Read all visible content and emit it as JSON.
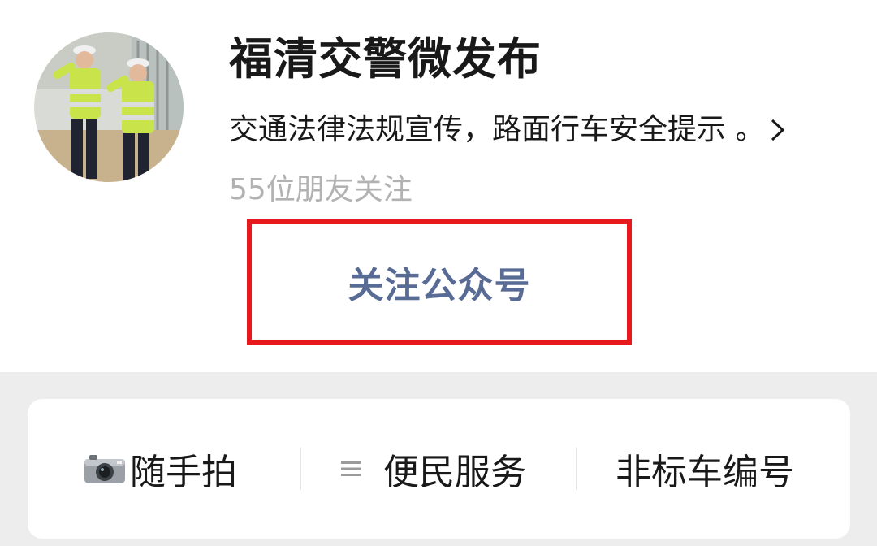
{
  "profile": {
    "account_name": "福清交警微发布",
    "description": "交通法律法规宣传，路面行车安全提示 。",
    "follower_count": "55位朋友关注",
    "follow_button_label": "关注公众号"
  },
  "menu": {
    "items": [
      {
        "label": "随手拍",
        "icon": "camera-icon"
      },
      {
        "label": "便民服务",
        "icon": "list-icon"
      },
      {
        "label": "非标车编号",
        "icon": ""
      }
    ]
  },
  "colors": {
    "link_blue": "#576b95",
    "highlight_red": "#e8191d",
    "secondary_gray": "#b2b2b2",
    "page_background": "#ededed"
  }
}
